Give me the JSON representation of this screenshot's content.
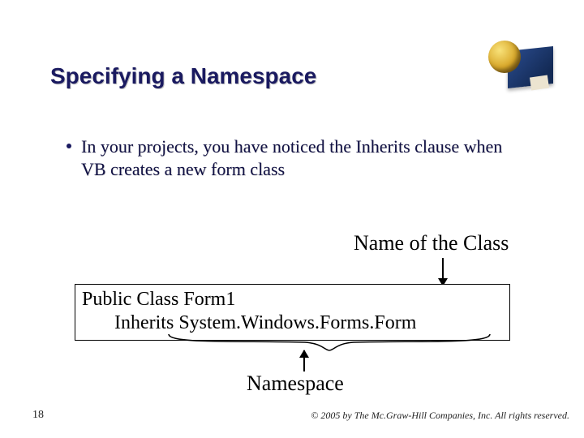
{
  "title": "Specifying a Namespace",
  "bullet": {
    "text": "In your projects, you have noticed the Inherits clause when VB creates a new form class"
  },
  "labels": {
    "class_name": "Name of the Class",
    "namespace": "Namespace"
  },
  "code": {
    "line1": "Public Class Form1",
    "line2": "Inherits System.Windows.Forms.Form"
  },
  "footer": {
    "page_number": "18",
    "copyright": "© 2005 by The Mc.Graw-Hill Companies, Inc. All rights reserved."
  }
}
